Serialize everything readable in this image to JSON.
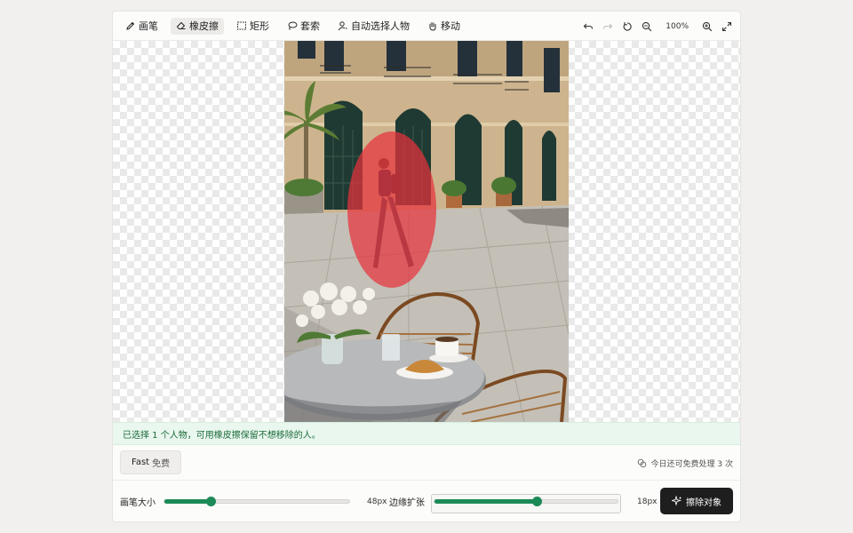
{
  "toolbar": {
    "tools": [
      {
        "label": "画笔",
        "icon": "pen-icon"
      },
      {
        "label": "橡皮擦",
        "icon": "eraser-icon"
      },
      {
        "label": "矩形",
        "icon": "rectangle-icon"
      },
      {
        "label": "套索",
        "icon": "lasso-icon"
      },
      {
        "label": "自动选择人物",
        "icon": "person-select-icon"
      },
      {
        "label": "移动",
        "icon": "hand-icon"
      }
    ],
    "active_tool": "橡皮擦",
    "zoom": "100%"
  },
  "info_message": "已选择 1 个人物，可用橡皮擦保留不想移除的人。",
  "mode": {
    "name": "Fast",
    "tag": "免费"
  },
  "quota": "今日还可免费处理 3 次",
  "controls": {
    "brush_size": {
      "label": "画笔大小",
      "value": "48px",
      "level": 0.25
    },
    "edge_expand": {
      "label": "边缘扩张",
      "value": "18px",
      "level": 0.56
    }
  },
  "erase_button": "擦除对象",
  "colors": {
    "accent_green": "#1c8a57",
    "mask_red": "#e6323c",
    "info_bg": "#e9f7ee",
    "primary_button": "#1e1e1e"
  }
}
